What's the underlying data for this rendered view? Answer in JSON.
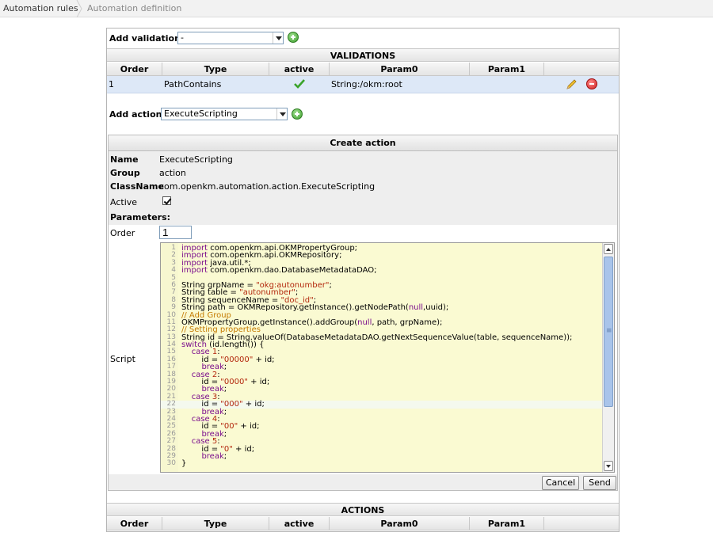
{
  "breadcrumb": {
    "items": [
      "Automation rules",
      "Automation definition"
    ]
  },
  "validation": {
    "add_label": "Add validation:",
    "select_value": "-",
    "section_title": "VALIDATIONS",
    "columns": [
      "Order",
      "Type",
      "active",
      "Param0",
      "Param1"
    ],
    "rows": [
      {
        "order": "1",
        "type": "PathContains",
        "active": true,
        "param0": "String:/okm:root",
        "param1": ""
      }
    ]
  },
  "action": {
    "add_label": "Add action:",
    "select_value": "ExecuteScripting",
    "create_title": "Create action",
    "name_label": "Name",
    "name_value": "ExecuteScripting",
    "group_label": "Group",
    "group_value": "action",
    "class_label": "ClassName",
    "class_value": "com.openkm.automation.action.ExecuteScripting",
    "active_label": "Active",
    "params_label": "Parameters:",
    "order_label": "Order",
    "order_value": "1",
    "script_label": "Script",
    "cancel_label": "Cancel",
    "send_label": "Send"
  },
  "actions_table": {
    "section_title": "ACTIONS",
    "columns": [
      "Order",
      "Type",
      "active",
      "Param0",
      "Param1"
    ]
  },
  "script_lines": [
    [
      [
        "kw",
        "import"
      ],
      [
        "n",
        " com.openkm.api.OKMPropertyGroup;"
      ]
    ],
    [
      [
        "kw",
        "import"
      ],
      [
        "n",
        " com.openkm.api.OKMRepository;"
      ]
    ],
    [
      [
        "kw",
        "import"
      ],
      [
        "n",
        " java.util.*;"
      ]
    ],
    [
      [
        "kw",
        "import"
      ],
      [
        "n",
        " com.openkm.dao.DatabaseMetadataDAO;"
      ]
    ],
    [],
    [
      [
        "n",
        "String grpName = "
      ],
      [
        "str",
        "\"okg:autonumber\""
      ],
      [
        "n",
        ";"
      ]
    ],
    [
      [
        "n",
        "String table = "
      ],
      [
        "str",
        "\"autonumber\""
      ],
      [
        "n",
        ";"
      ]
    ],
    [
      [
        "n",
        "String sequenceName = "
      ],
      [
        "str",
        "\"doc_id\""
      ],
      [
        "n",
        ";"
      ]
    ],
    [
      [
        "n",
        "String path = OKMRepository.getInstance().getNodePath("
      ],
      [
        "kw",
        "null"
      ],
      [
        "n",
        ",uuid);"
      ]
    ],
    [
      [
        "cm",
        "// Add Group"
      ]
    ],
    [
      [
        "n",
        "OKMPropertyGroup.getInstance().addGroup("
      ],
      [
        "kw",
        "null"
      ],
      [
        "n",
        ", path, grpName);"
      ]
    ],
    [
      [
        "cm",
        "// Setting properties"
      ]
    ],
    [
      [
        "n",
        "String id = String.valueOf(DatabaseMetadataDAO.getNextSequenceValue(table, sequenceName));"
      ]
    ],
    [
      [
        "kw",
        "switch"
      ],
      [
        "n",
        " (id.length()) {"
      ]
    ],
    [
      [
        "n",
        "    "
      ],
      [
        "kw",
        "case"
      ],
      [
        "n",
        " "
      ],
      [
        "str",
        "1"
      ],
      [
        "n",
        ":"
      ]
    ],
    [
      [
        "n",
        "        id = "
      ],
      [
        "str",
        "\"00000\""
      ],
      [
        "n",
        " + id;"
      ]
    ],
    [
      [
        "n",
        "        "
      ],
      [
        "kw",
        "break"
      ],
      [
        "n",
        ";"
      ]
    ],
    [
      [
        "n",
        "    "
      ],
      [
        "kw",
        "case"
      ],
      [
        "n",
        " "
      ],
      [
        "str",
        "2"
      ],
      [
        "n",
        ":"
      ]
    ],
    [
      [
        "n",
        "        id = "
      ],
      [
        "str",
        "\"0000\""
      ],
      [
        "n",
        " + id;"
      ]
    ],
    [
      [
        "n",
        "        "
      ],
      [
        "kw",
        "break"
      ],
      [
        "n",
        ";"
      ]
    ],
    [
      [
        "n",
        "    "
      ],
      [
        "kw",
        "case"
      ],
      [
        "n",
        " "
      ],
      [
        "str",
        "3"
      ],
      [
        "n",
        ":"
      ]
    ],
    [
      [
        "n",
        "        id = "
      ],
      [
        "str",
        "\"000\""
      ],
      [
        "n",
        " + id;"
      ]
    ],
    [
      [
        "n",
        "        "
      ],
      [
        "kw",
        "break"
      ],
      [
        "n",
        ";"
      ]
    ],
    [
      [
        "n",
        "    "
      ],
      [
        "kw",
        "case"
      ],
      [
        "n",
        " "
      ],
      [
        "str",
        "4"
      ],
      [
        "n",
        ":"
      ]
    ],
    [
      [
        "n",
        "        id = "
      ],
      [
        "str",
        "\"00\""
      ],
      [
        "n",
        " + id;"
      ]
    ],
    [
      [
        "n",
        "        "
      ],
      [
        "kw",
        "break"
      ],
      [
        "n",
        ";"
      ]
    ],
    [
      [
        "n",
        "    "
      ],
      [
        "kw",
        "case"
      ],
      [
        "n",
        " "
      ],
      [
        "str",
        "5"
      ],
      [
        "n",
        ":"
      ]
    ],
    [
      [
        "n",
        "        id = "
      ],
      [
        "str",
        "\"0\""
      ],
      [
        "n",
        " + id;"
      ]
    ],
    [
      [
        "n",
        "        "
      ],
      [
        "kw",
        "break"
      ],
      [
        "n",
        ";"
      ]
    ],
    [
      [
        "n",
        "}"
      ]
    ]
  ],
  "highlight_line": 22
}
